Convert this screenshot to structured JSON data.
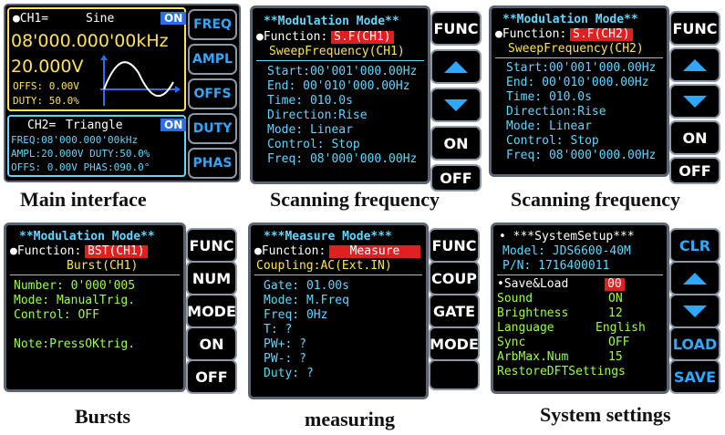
{
  "main": {
    "ch1_label": "●CH1=",
    "ch1_wave": "Sine",
    "ch1_on": "ON",
    "ch1_freq": "08'000.000'00kHz",
    "ch1_ampl": "20.000V",
    "ch1_offs": "OFFS:  0.00V",
    "ch1_duty": "DUTY:  50.0%",
    "ch2_label": "CH2=",
    "ch2_wave": "Triangle",
    "ch2_on": "ON",
    "ch2_freq": "FREQ:08'000.000'00kHz",
    "ch2_ampl": "AMPL:20.000V DUTY:50.0%",
    "ch2_offs": "OFFS:  0.00V PHAS:090.0°",
    "buttons": [
      "FREQ",
      "AMPL",
      "OFFS",
      "DUTY",
      "PHAS"
    ],
    "caption": "Main interface"
  },
  "sweep1": {
    "title": "**Modulation Mode**",
    "function_label": "●Function:",
    "function_value": "S.F(CH1)",
    "subtitle": "SweepFrequency(CH1)",
    "rows": [
      "Start:00'001'000.00Hz",
      "End:   00'010'000.00Hz",
      "Time:      010.0s",
      "Direction:Rise",
      "Mode:      Linear",
      "Control:   Stop",
      "Freq: 08'000'000.00Hz"
    ],
    "btn_func": "FUNC",
    "btn_on": "ON",
    "btn_off": "OFF",
    "caption": "Scanning frequency"
  },
  "sweep2": {
    "title": "**Modulation Mode**",
    "function_label": "●Function:",
    "function_value": "S.F(CH2)",
    "subtitle": "SweepFrequency(CH2)",
    "rows": [
      "Start:00'001'000.00Hz",
      "End:   00'010'000.00Hz",
      "Time:      010.0s",
      "Direction:Rise",
      "Mode:      Linear",
      "Control:   Stop",
      "Freq: 08'000'000.00Hz"
    ],
    "btn_func": "FUNC",
    "btn_on": "ON",
    "btn_off": "OFF",
    "caption": "Scanning frequency"
  },
  "burst": {
    "title": "**Modulation Mode**",
    "function_label": "●Function:",
    "function_value": "BST(CH1)",
    "subtitle": "Burst(CH1)",
    "rows": [
      "Number:  0'000'005",
      "Mode: ManualTrig.",
      "Control:   OFF"
    ],
    "note": "Note:PressOKtrig.",
    "buttons": [
      "FUNC",
      "NUM",
      "MODE",
      "ON",
      "OFF"
    ],
    "caption": "Bursts"
  },
  "measure": {
    "title": "***Measure Mode***",
    "function_label": "●Function:",
    "function_value": "Measure",
    "coupling": "Coupling:AC(Ext.IN)",
    "rows": [
      "Gate:      01.00s",
      "Mode:       M.Freq",
      "Freq:         0Hz",
      "T:              ?",
      "PW+:            ?",
      "PW-:            ?",
      "Duty:           ?"
    ],
    "buttons": [
      "FUNC",
      "COUP",
      "GATE",
      "MODE"
    ],
    "caption": "measuring"
  },
  "system": {
    "title": "• ***SystemSetup***",
    "model": "Model:    JDS6600-40M",
    "pn": "P/N:       1716400011",
    "rows": [
      {
        "label": "•Save&Load",
        "value": "00",
        "hl": true
      },
      {
        "label": " Sound",
        "value": "ON",
        "hl": false
      },
      {
        "label": " Brightness",
        "value": "12",
        "hl": false
      },
      {
        "label": " Language",
        "value": "English",
        "hl": false
      },
      {
        "label": " Sync",
        "value": "OFF",
        "hl": false
      },
      {
        "label": " ArbMax.Num",
        "value": "15",
        "hl": false
      },
      {
        "label": " RestoreDFTSettings",
        "value": "",
        "hl": false
      }
    ],
    "buttons": [
      "CLR",
      "LOAD",
      "SAVE"
    ],
    "caption": "System settings"
  }
}
